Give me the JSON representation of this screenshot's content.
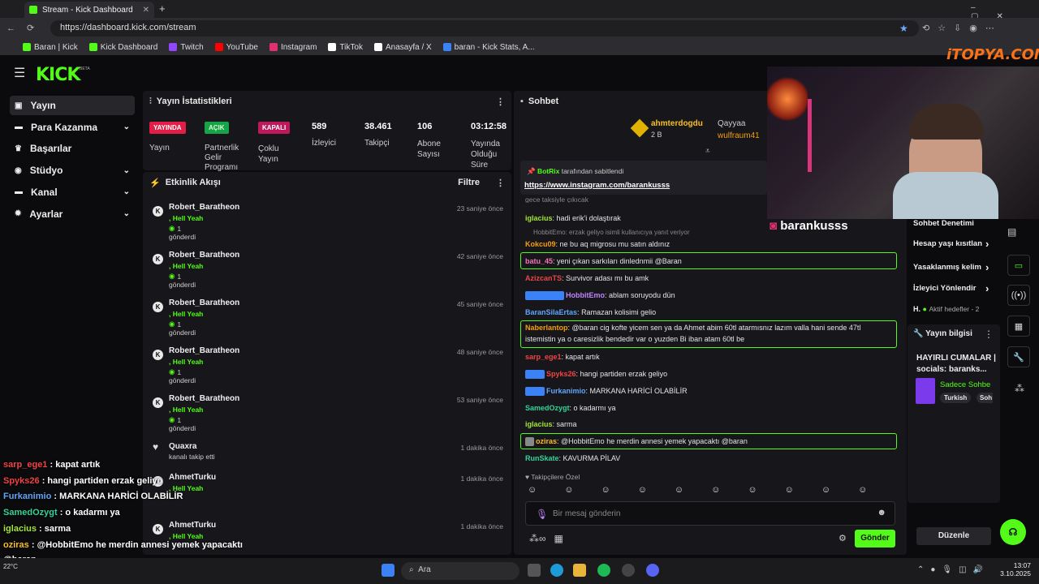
{
  "browser": {
    "tab_title": "Stream - Kick Dashboard",
    "url": "https://dashboard.kick.com/stream",
    "bookmarks": [
      {
        "label": "Baran | Kick",
        "color": "#53fc18"
      },
      {
        "label": "Kick Dashboard",
        "color": "#53fc18"
      },
      {
        "label": "Twitch",
        "color": "#9146ff"
      },
      {
        "label": "YouTube",
        "color": "#ff0000"
      },
      {
        "label": "Instagram",
        "color": "#e1306c"
      },
      {
        "label": "TikTok",
        "color": "#ffffff"
      },
      {
        "label": "Anasayfa / X",
        "color": "#ffffff"
      },
      {
        "label": "baran - Kick Stats, A...",
        "color": "#3b82f6"
      }
    ]
  },
  "brand": {
    "logo": "KICK",
    "beta": "BETA",
    "watermark": "iTOPYA.COM"
  },
  "sidebar": {
    "items": [
      {
        "label": "Yayın",
        "icon": "home-icon"
      },
      {
        "label": "Para Kazanma",
        "icon": "money-icon"
      },
      {
        "label": "Başarılar",
        "icon": "trophy-icon"
      },
      {
        "label": "Stüdyo",
        "icon": "studio-icon"
      },
      {
        "label": "Kanal",
        "icon": "channel-icon"
      },
      {
        "label": "Ayarlar",
        "icon": "gear-icon"
      }
    ]
  },
  "stats": {
    "title": "Yayın İstatistikleri",
    "yayin_badge": "YAYINDA",
    "yayin_label": "Yayın",
    "partner_badge": "AÇIK",
    "partner_label": "Partnerlik Gelir Programı",
    "multi_badge": "KAPALI",
    "multi_label": "Çoklu Yayın",
    "viewers": "589",
    "viewers_label": "İzleyici",
    "followers": "38.461",
    "followers_label": "Takipçi",
    "subs": "106",
    "subs_label": "Abone Sayısı",
    "duration": "03:12:58",
    "duration_label": "Yayında Olduğu Süre"
  },
  "activity": {
    "title": "Etkinlik Akışı",
    "filter": "Filtre",
    "items": [
      {
        "name": "Robert_Baratheon",
        "gift": ", Hell Yeah",
        "count": "1",
        "action": "gönderdi",
        "time": "23 saniye önce"
      },
      {
        "name": "Robert_Baratheon",
        "gift": ", Hell Yeah",
        "count": "1",
        "action": "gönderdi",
        "time": "42 saniye önce"
      },
      {
        "name": "Robert_Baratheon",
        "gift": ", Hell Yeah",
        "count": "1",
        "action": "gönderdi",
        "time": "45 saniye önce"
      },
      {
        "name": "Robert_Baratheon",
        "gift": ", Hell Yeah",
        "count": "1",
        "action": "gönderdi",
        "time": "48 saniye önce"
      },
      {
        "name": "Robert_Baratheon",
        "gift": ", Hell Yeah",
        "count": "1",
        "action": "gönderdi",
        "time": "53 saniye önce"
      }
    ],
    "follow": {
      "name": "Quaxra",
      "text": "kanalı takip etti",
      "time": "1 dakika önce"
    },
    "extra": [
      {
        "name": "AhmetTurku",
        "gift": ", Hell Yeah",
        "time": "1 dakika önce"
      },
      {
        "name": "AhmetTurku",
        "gift": ", Hell Yeah",
        "time": "1 dakika önce"
      }
    ]
  },
  "chat": {
    "title": "Sohbet",
    "top_user": "ahmterdogdu",
    "top_amount": "2 B",
    "leader2": "Qayyaa",
    "leader3": "wulfraum41",
    "pinned_by": "BotRix",
    "pinned_text": "tarafından sabitlendi",
    "pinned_link": "https://www.instagram.com/barankusss",
    "partial": "gece taksiyle çıkıcak",
    "reply_ctx": "HobbitEmo: erzak geliyo isimli kullanıcıya yanıt veriyor",
    "messages": [
      {
        "user": "iglacius",
        "color": "#a3e635",
        "text": "hadi erik'i dolaştırak"
      },
      {
        "user": "Kokcu09",
        "color": "#f59e0b",
        "text": "ne bu aq migrosu mu satın aldınız"
      },
      {
        "user": "batu_45",
        "color": "#f472b6",
        "text": "yeni çıkan sarkıları dinlednmii @Baran"
      },
      {
        "user": "AzizcanTS",
        "color": "#ef4444",
        "text": "Survivor adası mı bu amk"
      },
      {
        "user": "HobbitEmo",
        "color": "#c084fc",
        "text": "ablam soruyodu dün"
      },
      {
        "user": "BaranSilaErtas",
        "color": "#60a5fa",
        "text": "Ramazan kolisimi gelio"
      },
      {
        "user": "Naberlantop",
        "color": "#f59e0b",
        "text": "@baran cig kofte yicem sen ya da Ahmet abim 60tl atarmısnız lazım valla hani sende 47tl",
        "text2": "istemistin ya o caresizlik bendedir var o yuzden Bi iban atam 60tl be"
      },
      {
        "user": "sarp_ege1",
        "color": "#ef4444",
        "text": "kapat artık"
      },
      {
        "user": "Spyks26",
        "color": "#ef4444",
        "text": "hangi partiden erzak geliyo"
      },
      {
        "user": "Furkanimio",
        "color": "#60a5fa",
        "text": "MARKANA HARİCİ OLABİLİR"
      },
      {
        "user": "SamedOzygt",
        "color": "#34d399",
        "text": "o kadarmı ya"
      },
      {
        "user": "iglacius",
        "color": "#a3e635",
        "text": "sarma"
      },
      {
        "user": "oziras",
        "color": "#fbbf24",
        "text": "@HobbitEmo he merdin annesi yemek yapacaktı @baran"
      },
      {
        "user": "RunSkate",
        "color": "#34d399",
        "text": "KAVURMA PİLAV"
      }
    ],
    "followers_only": "Takipçilere Özel",
    "placeholder": "Bir mesaj gönderin",
    "send": "Gönder"
  },
  "right": {
    "streamer": "barankusss",
    "items": [
      "Sohbet Denetimi",
      "Hesap yaşı kısıtlan",
      "Yasaklanmış kelim",
      "İzleyici Yönlendir"
    ],
    "goals": "Aktif hedefler - 2",
    "goals_prefix": "H.",
    "info_title": "Yayın bilgisi",
    "stream_title": "HAYIRLI CUMALAR |",
    "socials": "socials: baranks...",
    "category": "Sadece Sohbe",
    "tag1": "Turkish",
    "tag2": "Soh",
    "edit": "Düzenle"
  },
  "overlay": [
    {
      "user": "sarp_ege1",
      "color": "#ef4444",
      "text": " : kapat artık"
    },
    {
      "user": "Spyks26",
      "color": "#ef4444",
      "text": " : hangi partiden erzak geliyo"
    },
    {
      "user": "Furkanimio",
      "color": "#60a5fa",
      "text": " : MARKANA HARİCİ OLABİLİR"
    },
    {
      "user": "SamedOzygt",
      "color": "#34d399",
      "text": " : o kadarmı ya"
    },
    {
      "user": "iglacius",
      "color": "#a3e635",
      "text": " : sarma"
    },
    {
      "user": "oziras",
      "color": "#fbbf24",
      "text": " : @HobbitEmo he merdin annesi yemek yapacaktı"
    },
    {
      "user": "",
      "color": "#ffffff",
      "text": "@baran"
    },
    {
      "user": "RunSkate",
      "color": "#34d399",
      "text": " : KAVURMA PİLAV"
    }
  ],
  "taskbar": {
    "search": "Ara",
    "weather": "22°C",
    "time": "13:07",
    "date": "3.10.2025"
  }
}
